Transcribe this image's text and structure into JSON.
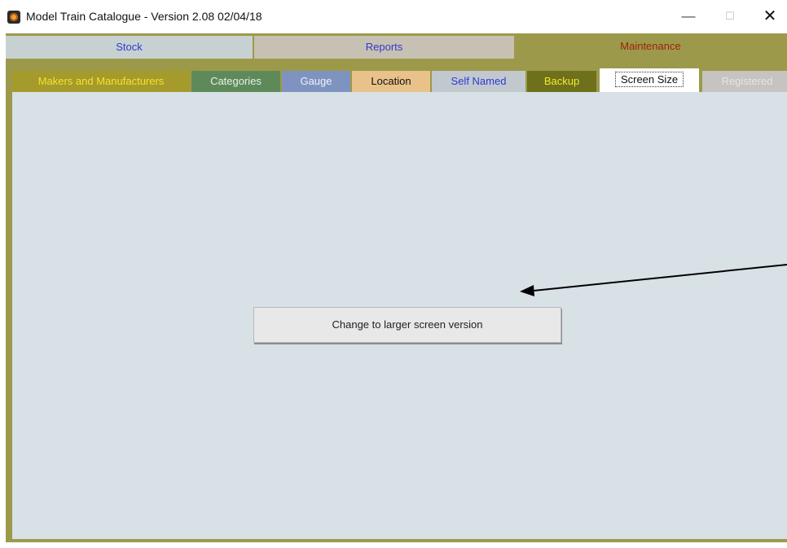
{
  "window": {
    "title": "Model Train Catalogue -  Version 2.08  02/04/18",
    "minimize_glyph": "—",
    "maximize_glyph": "☐",
    "close_glyph": "✕"
  },
  "main_tabs": [
    {
      "label": "Stock"
    },
    {
      "label": "Reports"
    },
    {
      "label": "Maintenance",
      "selected": true
    }
  ],
  "sub_tabs": [
    {
      "label": "Makers and Manufacturers"
    },
    {
      "label": "Categories"
    },
    {
      "label": "Gauge"
    },
    {
      "label": "Location"
    },
    {
      "label": "Self Named"
    },
    {
      "label": "Backup"
    },
    {
      "label": "Screen Size",
      "selected": true
    },
    {
      "label": "Registered",
      "disabled": true
    }
  ],
  "content": {
    "action_button_label": "Change to larger screen version"
  },
  "icons": {
    "app": "train-app-icon",
    "annotation": "arrow-icon"
  },
  "colors": {
    "maintenance_bg": "#9c9a4a",
    "panel_bg": "#d7e1e6",
    "tab_text_blue": "#2f3bd0",
    "maintenance_text": "#a02010"
  }
}
